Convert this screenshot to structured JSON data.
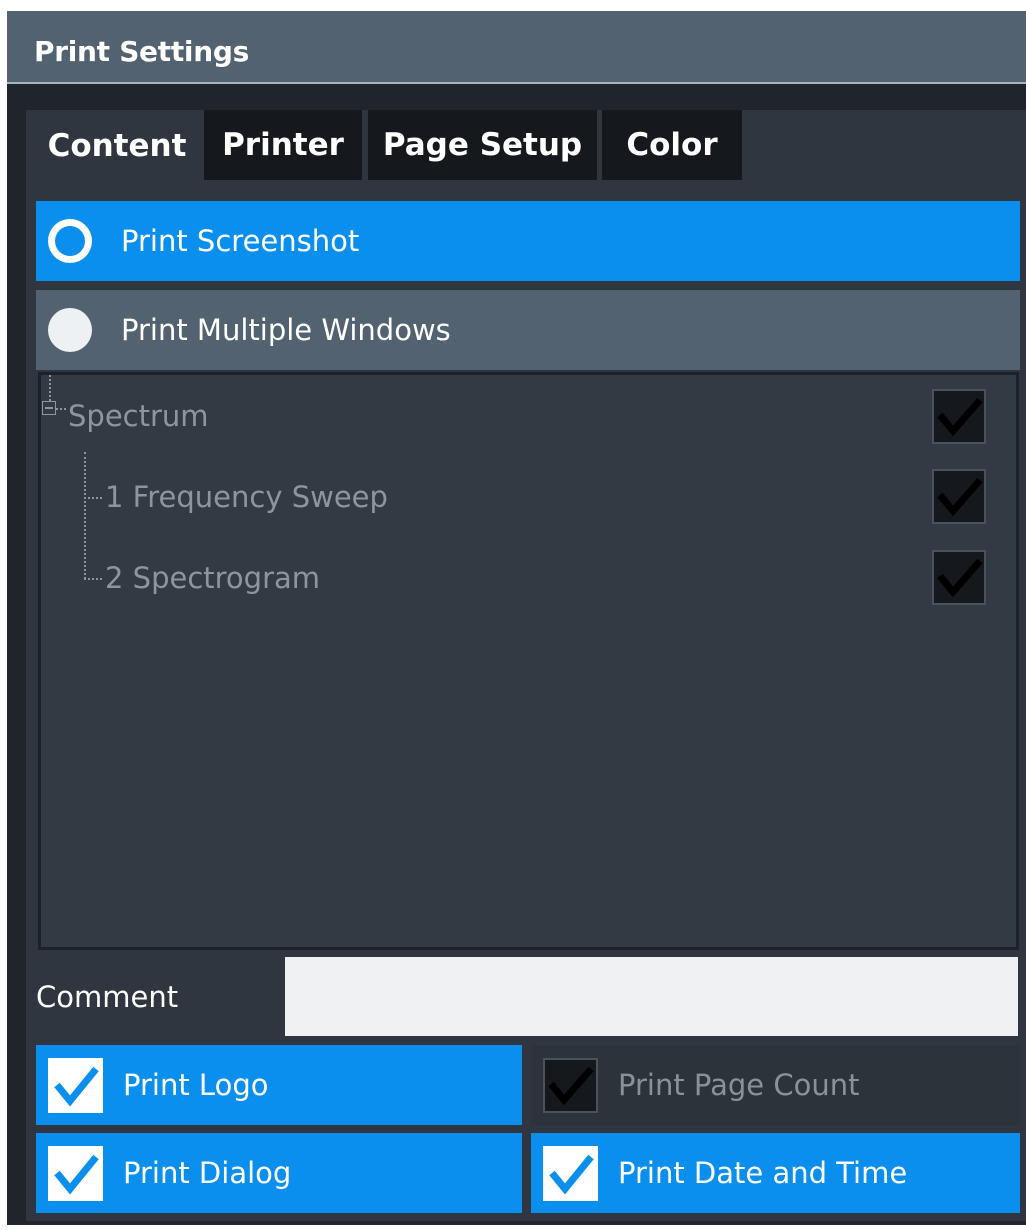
{
  "dialog": {
    "title": "Print Settings",
    "tabs": [
      {
        "label": "Content",
        "active": true
      },
      {
        "label": "Printer",
        "active": false
      },
      {
        "label": "Page Setup",
        "active": false
      },
      {
        "label": "Color",
        "active": false
      }
    ]
  },
  "content": {
    "print_mode": {
      "options": [
        {
          "label": "Print Screenshot",
          "selected": true
        },
        {
          "label": "Print Multiple Windows",
          "selected": false
        }
      ]
    },
    "window_tree": {
      "root": {
        "label": "Spectrum",
        "checked": true,
        "expanded": true
      },
      "children": [
        {
          "label": "1 Frequency Sweep",
          "checked": true
        },
        {
          "label": "2 Spectrogram",
          "checked": true
        }
      ]
    },
    "comment": {
      "label": "Comment",
      "value": ""
    },
    "checkboxes": [
      {
        "label": "Print Logo",
        "checked": true,
        "enabled": true
      },
      {
        "label": "Print Page Count",
        "checked": true,
        "enabled": false
      },
      {
        "label": "Print Dialog",
        "checked": true,
        "enabled": true
      },
      {
        "label": "Print Date and Time",
        "checked": true,
        "enabled": true
      }
    ]
  },
  "colors": {
    "accent": "#0a8fef",
    "title_bar": "#526271",
    "panel": "#2f363f",
    "tab_inactive": "#15191e",
    "disabled_text": "#8d959d"
  },
  "icons": {
    "radio_selected": "radio-selected-icon",
    "radio_unselected": "radio-unselected-icon",
    "checkmark": "checkmark-icon",
    "tree_collapse": "tree-collapse-icon"
  }
}
